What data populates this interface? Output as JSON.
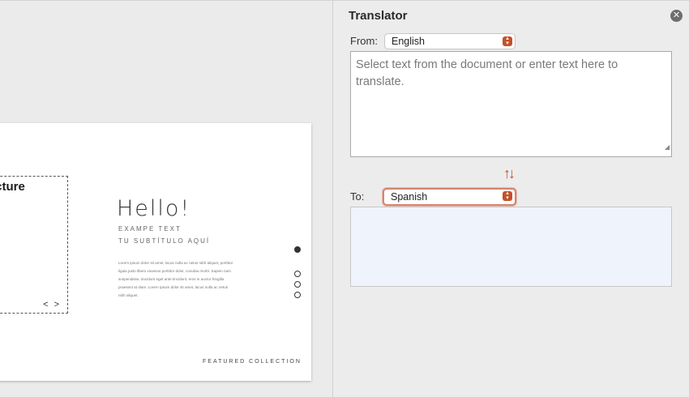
{
  "slide": {
    "picture_label": "icture",
    "picture_nav": "< >",
    "hello": "Hello!",
    "example_text": "EXAMPE TEXT",
    "subtitle": "TU SUBTÍTULO AQUÍ",
    "body": "Lorem ipsum dolor sit amet, lacus nulla ac netus nibh aliquet, porttitor ligula justo libero vivamus porttitor dolor, conubia morbi. Sapien nam suspendisse, tincidunt eget ante tincidunt, eros in auctor fringilla praesent at diam. Lorem ipsum dolor sit amet, lacus nulla ac netus nibh aliquet.",
    "featured": "FEATURED COLLECTION"
  },
  "translator": {
    "title": "Translator",
    "close_icon": "close-circle-icon",
    "from_label": "From:",
    "from_value": "English",
    "source_placeholder": "Select text from the document or enter text here to translate.",
    "swap_icon": "swap-arrows-icon",
    "to_label": "To:",
    "to_value": "Spanish",
    "target_text": "",
    "accent_color": "#c35128"
  }
}
